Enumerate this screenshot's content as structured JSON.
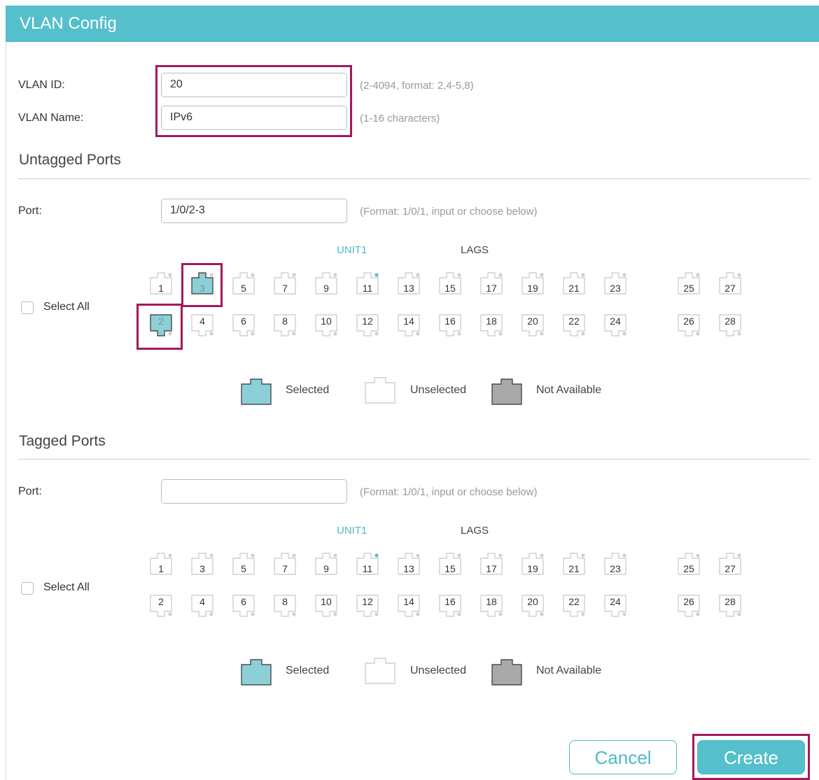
{
  "header": {
    "title": "VLAN Config"
  },
  "vlan_id": {
    "label": "VLAN ID:",
    "value": "20",
    "hint": "(2-4094, format: 2,4-5,8)"
  },
  "vlan_name": {
    "label": "VLAN Name:",
    "value": "IPv6",
    "hint": "(1-16 characters)"
  },
  "untagged": {
    "title": "Untagged Ports",
    "port_label": "Port:",
    "port_value": "1/0/2-3",
    "hint": "(Format: 1/0/1, input or choose below)",
    "unit_label": "UNIT1",
    "lags_label": "LAGS",
    "select_all": "Select All",
    "selected_ports": [
      "2",
      "3"
    ],
    "top_row": [
      "1",
      "3",
      "5",
      "7",
      "9",
      "11",
      "13",
      "15",
      "17",
      "19",
      "21",
      "23",
      "25",
      "27"
    ],
    "bottom_row": [
      "2",
      "4",
      "6",
      "8",
      "10",
      "12",
      "14",
      "16",
      "18",
      "20",
      "22",
      "24",
      "26",
      "28"
    ]
  },
  "tagged": {
    "title": "Tagged Ports",
    "port_label": "Port:",
    "port_value": "",
    "hint": "(Format: 1/0/1, input or choose below)",
    "unit_label": "UNIT1",
    "lags_label": "LAGS",
    "select_all": "Select All",
    "selected_ports": [],
    "top_row": [
      "1",
      "3",
      "5",
      "7",
      "9",
      "11",
      "13",
      "15",
      "17",
      "19",
      "21",
      "23",
      "25",
      "27"
    ],
    "bottom_row": [
      "2",
      "4",
      "6",
      "8",
      "10",
      "12",
      "14",
      "16",
      "18",
      "20",
      "22",
      "24",
      "26",
      "28"
    ]
  },
  "legend": {
    "selected": "Selected",
    "unselected": "Unselected",
    "not_available": "Not Available"
  },
  "colors": {
    "accent": "#55bfcb",
    "selected_port": "#8ccfd7",
    "not_available_port": "#a9a9a9",
    "highlight": "#a3195b"
  },
  "buttons": {
    "cancel": "Cancel",
    "create": "Create"
  }
}
